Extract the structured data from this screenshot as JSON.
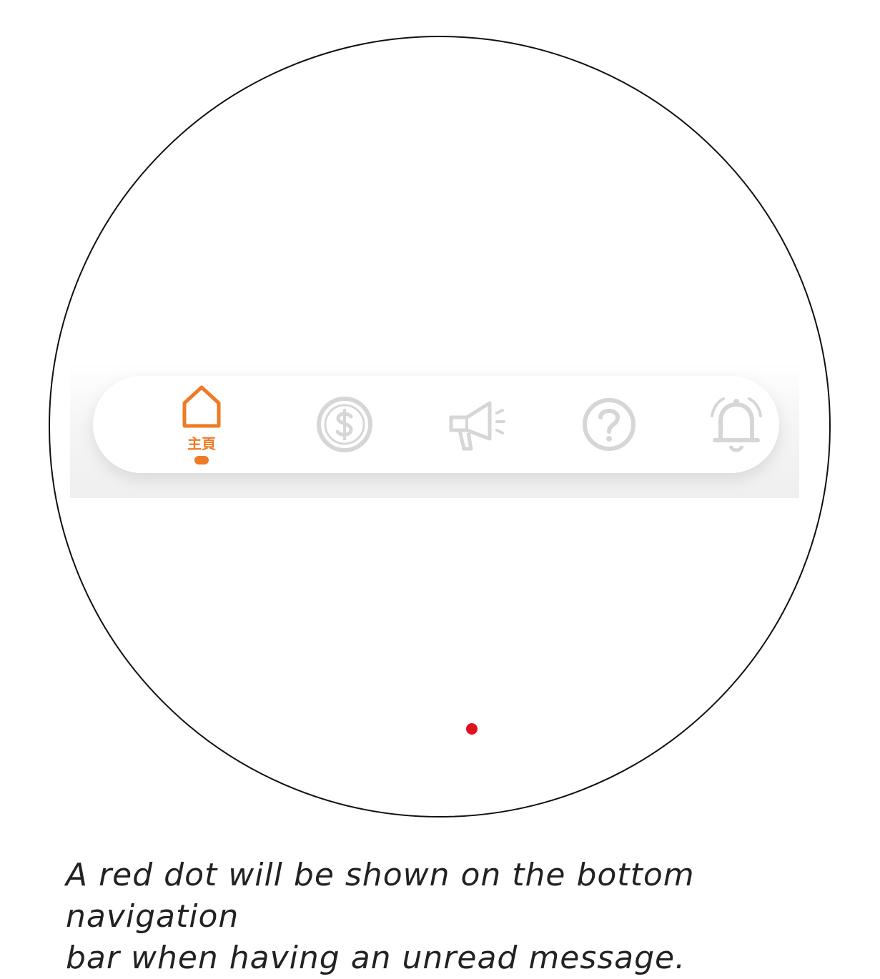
{
  "colors": {
    "active": "#EF7A26",
    "inactive": "#D6D6D6",
    "badge": "#E0101D",
    "outline": "#111111"
  },
  "bottom_nav": {
    "items": [
      {
        "icon": "home-icon",
        "label": "主頁",
        "active": true
      },
      {
        "icon": "dollar-icon",
        "label": "",
        "active": false
      },
      {
        "icon": "megaphone-icon",
        "label": "",
        "active": false,
        "unread_badge": true
      },
      {
        "icon": "help-icon",
        "label": "",
        "active": false
      },
      {
        "icon": "bell-icon",
        "label": "",
        "active": false
      }
    ]
  },
  "caption": {
    "line1": "A red dot will be shown on the bottom navigation",
    "line2": "bar when having an unread message."
  }
}
